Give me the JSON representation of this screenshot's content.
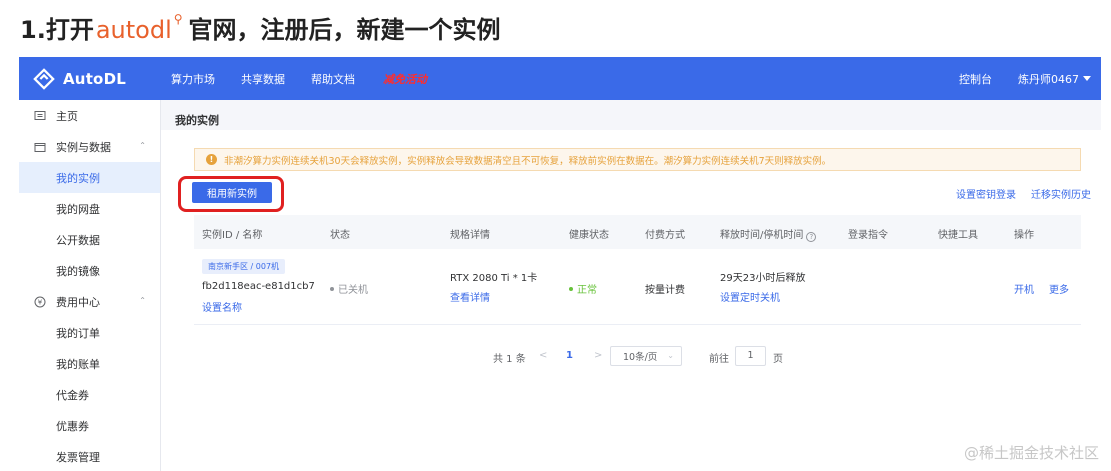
{
  "heading": {
    "prefix": "1.打开",
    "link_text": "autodl",
    "suffix": "官网，注册后，新建一个实例"
  },
  "topnav": {
    "brand": "AutoDL",
    "items": [
      "算力市场",
      "共享数据",
      "帮助文档"
    ],
    "promo": "减免活动",
    "console": "控制台",
    "user": "炼丹师0467"
  },
  "sidebar": {
    "items": [
      {
        "label": "主页"
      },
      {
        "label": "实例与数据"
      },
      {
        "label": "我的实例"
      },
      {
        "label": "我的网盘"
      },
      {
        "label": "公开数据"
      },
      {
        "label": "我的镜像"
      },
      {
        "label": "费用中心"
      },
      {
        "label": "我的订单"
      },
      {
        "label": "我的账单"
      },
      {
        "label": "代金券"
      },
      {
        "label": "优惠券"
      },
      {
        "label": "发票管理"
      }
    ]
  },
  "main": {
    "title": "我的实例",
    "alert": "非潮汐算力实例连续关机30天会释放实例，实例释放会导致数据清空且不可恢复，释放前实例在数据在。潮汐算力实例连续关机7天则释放实例。",
    "rent_button": "租用新实例",
    "links": [
      "设置密钥登录",
      "迁移实例历史"
    ]
  },
  "table": {
    "headers": [
      "实例ID / 名称",
      "状态",
      "规格详情",
      "健康状态",
      "付费方式",
      "释放时间/停机时间",
      "登录指令",
      "快捷工具",
      "操作"
    ],
    "row": {
      "region": "南京新手区 / 007机",
      "instance_id": "fb2d118eac-e81d1cb7",
      "set_name": "设置名称",
      "status": "已关机",
      "gpu": "RTX 2080 Ti * 1卡",
      "spec_link": "查看详情",
      "health": "正常",
      "billing": "按量计费",
      "release_time": "29天23小时后释放",
      "shutdown_link": "设置定时关机",
      "action_start": "开机",
      "action_more": "更多"
    }
  },
  "pagination": {
    "total": "共 1 条",
    "prev": "<",
    "current_page": "1",
    "next": ">",
    "page_size": "10条/页",
    "goto_label": "前往",
    "goto_value": "1",
    "page_unit": "页"
  },
  "watermark": "@稀土掘金技术社区",
  "colors": {
    "brand": "#3a6ae8",
    "warning": "#e6a23c",
    "danger": "#e02020",
    "success": "#67c23a"
  }
}
